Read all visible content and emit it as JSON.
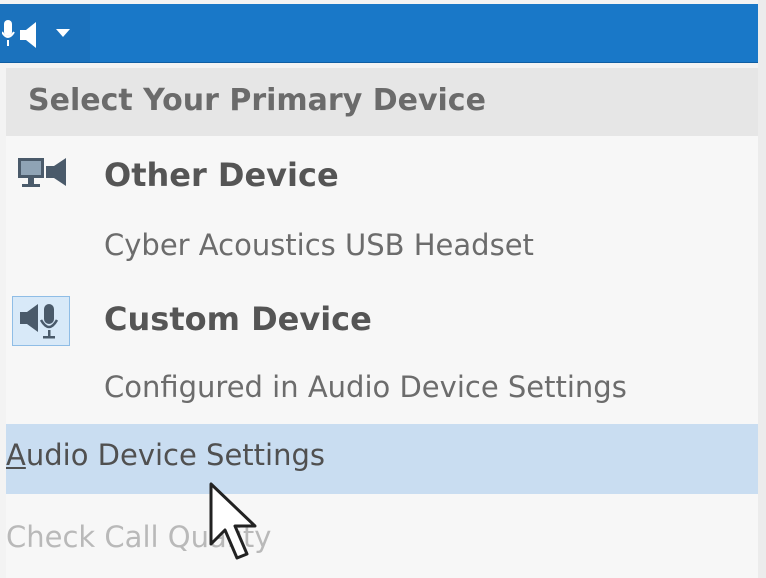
{
  "colors": {
    "titlebar": "#1978c8",
    "menu_background": "#f7f7f7",
    "header_background": "#e6e6e6",
    "highlight": "#c9ddf1",
    "disabled_text": "#b9b9b9"
  },
  "toolbar": {
    "device_button_icon": "microphone-speaker-icon",
    "dropdown_icon": "chevron-down-icon"
  },
  "menu": {
    "header": "Select Your Primary Device",
    "devices": [
      {
        "icon": "monitor-speaker-icon",
        "title": "Other Device",
        "detail": "Cyber Acoustics USB Headset"
      },
      {
        "icon": "speaker-microphone-icon",
        "title": "Custom Device",
        "detail": "Configured in Audio Device Settings",
        "selected": true
      }
    ],
    "actions": [
      {
        "mnemonic": "A",
        "rest": "udio Device Settings",
        "highlighted": true
      },
      {
        "label": "Check Call Quality",
        "enabled": false
      }
    ]
  },
  "cursor": {
    "icon": "arrow-cursor-icon"
  }
}
